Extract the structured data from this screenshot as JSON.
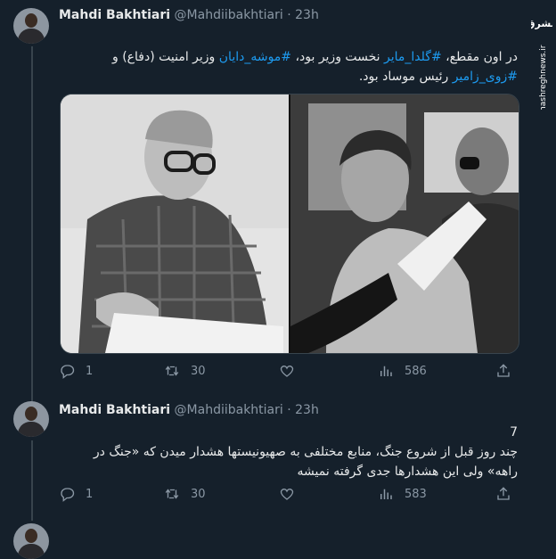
{
  "tweet1": {
    "name": "Mahdi Bakhtiari",
    "handle": "@Mahdiibakhtiari",
    "time": "23h",
    "text_line1_prefix": "در اون مقطع، ",
    "tag1": "#گلدا_مایر",
    "text_mid1": " نخست وزیر بود، ",
    "tag2": "#موشه_دایان",
    "text_mid2": " وزیر امنیت (دفاع) و",
    "tag3": "#زوی_زامیر",
    "text_end": " رئیس موساد بود.",
    "replies": "1",
    "retweets": "30",
    "views": "586"
  },
  "tweet2": {
    "name": "Mahdi Bakhtiari",
    "handle": "@Mahdiibakhtiari",
    "time": "23h",
    "number": "7",
    "text_line1": "چند روز قبل از شروع جنگ، منابع مختلفی به صهیونیستها هشدار میدن که «جنگ در",
    "text_line2": "راهه» ولی این هشدارها جدی گرفته نمیشه",
    "replies": "1",
    "retweets": "30",
    "views": "583"
  },
  "watermark": {
    "url": "mashreghnews.ir",
    "logo_text": "مشرق"
  },
  "colors": {
    "background": "#15202b",
    "text": "#e7e9ea",
    "muted": "#8b98a5",
    "accent": "#1d9bf0",
    "border": "#38444d"
  }
}
